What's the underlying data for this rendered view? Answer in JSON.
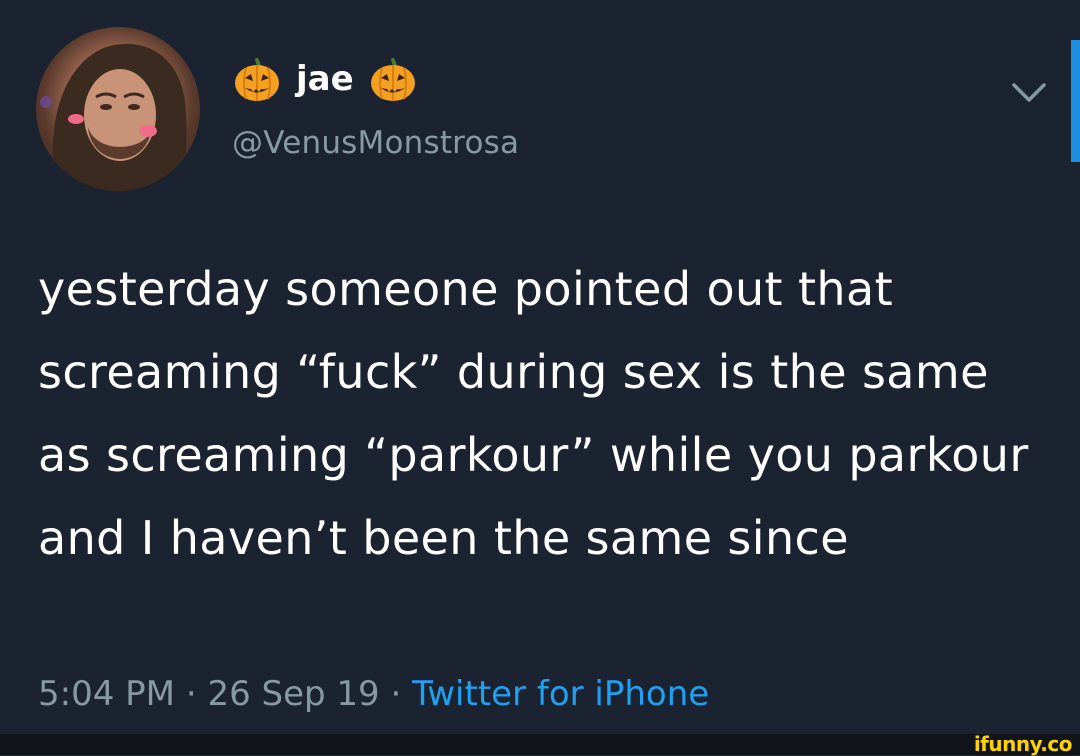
{
  "tweet": {
    "display_name": "jae",
    "name_emoji": "pumpkin-icon",
    "handle": "@VenusMonstrosa",
    "text": "yesterday someone pointed out that screaming “fuck” during sex is the same as screaming “parkour” while you parkour and I haven’t been the same since",
    "time": "5:04 PM",
    "date": "26 Sep 19",
    "separator": "·",
    "source": "Twitter for iPhone"
  },
  "watermark": {
    "text": "ifunny.co"
  },
  "colors": {
    "background": "#1b2330",
    "text": "#ffffff",
    "muted": "#8899a6",
    "link": "#1da1f2",
    "accent_bar": "#1d8ee0",
    "watermark": "#ffd200"
  }
}
